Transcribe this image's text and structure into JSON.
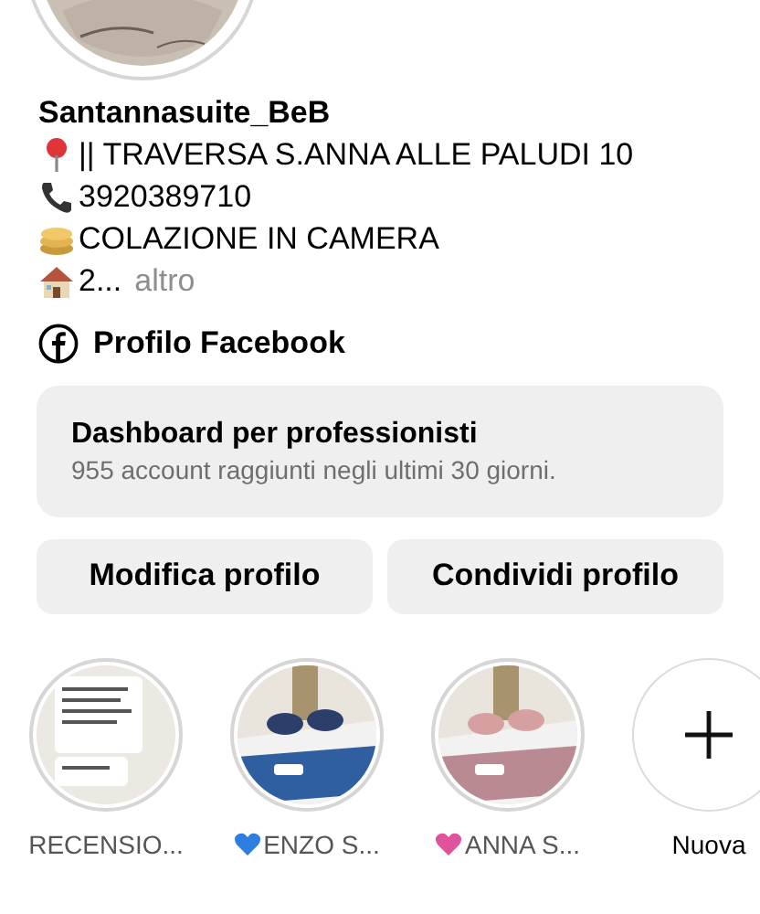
{
  "profile": {
    "username": "Santannasuite_BeB",
    "bio_lines": [
      {
        "kind": "pin",
        "text": "|| TRAVERSA S.ANNA ALLE PALUDI 10"
      },
      {
        "kind": "phone",
        "text": "3920389710"
      },
      {
        "kind": "pancakes",
        "text": "COLAZIONE IN CAMERA"
      },
      {
        "kind": "house",
        "text": "2...",
        "more": "altro"
      }
    ],
    "facebook_link": "Profilo Facebook"
  },
  "dashboard": {
    "title": "Dashboard per professionisti",
    "subtitle": "955 account raggiunti negli ultimi 30 giorni."
  },
  "buttons": [
    "Modifica profilo",
    "Condividi profilo"
  ],
  "highlights": [
    {
      "kind": "text",
      "label": "RECENSIO..."
    },
    {
      "kind": "blue",
      "label": "ENZO S..."
    },
    {
      "kind": "pink",
      "label": "ANNA S..."
    },
    {
      "kind": "new",
      "label": "Nuova"
    }
  ]
}
